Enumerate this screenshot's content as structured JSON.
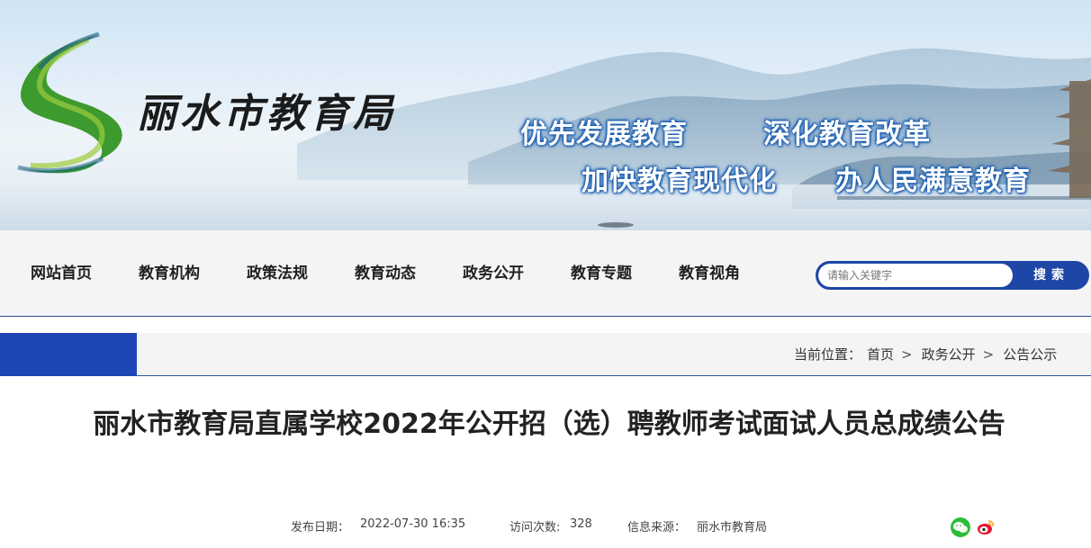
{
  "site": {
    "name": "丽水市教育局",
    "slogans": [
      "优先发展教育",
      "深化教育改革",
      "加快教育现代化",
      "办人民满意教育"
    ]
  },
  "nav": {
    "items": [
      {
        "label": "网站首页"
      },
      {
        "label": "教育机构"
      },
      {
        "label": "政策法规"
      },
      {
        "label": "教育动态"
      },
      {
        "label": "政务公开"
      },
      {
        "label": "教育专题"
      },
      {
        "label": "教育视角"
      }
    ],
    "search_placeholder": "请输入关键字",
    "search_button": "搜索"
  },
  "breadcrumb": {
    "prefix": "当前位置：",
    "items": [
      "首页",
      "政务公开",
      "公告公示"
    ],
    "separator": ">"
  },
  "article": {
    "title": "丽水市教育局直属学校2022年公开招（选）聘教师考试面试人员总成绩公告",
    "date_label": "发布日期：",
    "date": "2022-07-30 16:35",
    "views_label": "访问次数:",
    "views": "328",
    "source_label": "信息来源：",
    "source": "丽水市教育局"
  },
  "share": {
    "icons": [
      "wechat-icon",
      "weibo-icon"
    ]
  },
  "colors": {
    "brand_blue": "#1e46a6",
    "nav_bg": "#f4f4f4",
    "wechat_green": "#2bbd3a",
    "weibo_red": "#e6162d"
  }
}
